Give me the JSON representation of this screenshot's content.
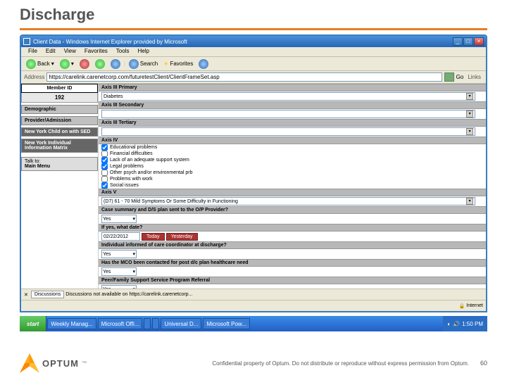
{
  "slide": {
    "title": "Discharge",
    "page": "60"
  },
  "footer": "Confidential property of Optum. Do not distribute or reproduce without express permission from Optum.",
  "logo": "OPTUM",
  "ie": {
    "title": "Client Data - Windows Internet Explorer provided by Microsoft",
    "menu": [
      "File",
      "Edit",
      "View",
      "Favorites",
      "Tools",
      "Help"
    ],
    "back": "Back",
    "search": "Search",
    "favorites": "Favorites",
    "address_label": "Address",
    "url": "https://carelink.carenetcorp.com/futuretestClient/ClientFrameSet.asp",
    "go": "Go",
    "links": "Links",
    "discussions_tab": "Discussions",
    "discussions_msg": "Discussions not available on https://carelink.carenetcorp...",
    "internet": "Internet",
    "sidebar": {
      "member_label": "Member ID",
      "member_value": "192",
      "items": [
        "Demographic",
        "Provider/Admission",
        "New York Child on with SED",
        "New York Individual Information Matrix"
      ],
      "talk_to": "Talk to:",
      "main_menu": "Main Menu"
    },
    "sections": {
      "axis3p": "Axis III Primary",
      "axis3p_val": "Diabetes",
      "axis3s": "Axis III Secondary",
      "axis3t": "Axis III Tertiary",
      "axis4": "Axis IV",
      "axis4_items": [
        {
          "label": "Educational problems",
          "checked": true
        },
        {
          "label": "Financial difficulties",
          "checked": false
        },
        {
          "label": "Lack of an adequate support system",
          "checked": true
        },
        {
          "label": "Legal problems",
          "checked": true
        },
        {
          "label": "Other psych and/or environmental prb",
          "checked": false
        },
        {
          "label": "Problems with work",
          "checked": false
        },
        {
          "label": "Social issues",
          "checked": true
        }
      ],
      "axis5": "Axis V",
      "axis5_val": "(D7) 61 - 70 Mild Symptoms Or Some Difficulty in Functioning",
      "case_summary": "Case summary and D/S plan sent to the O/P Provider?",
      "yes": "Yes",
      "if_yes": "If yes, what date?",
      "date": "02/22/2012",
      "today": "Today",
      "yesterday": "Yesterday",
      "informed": "Individual informed of care coordinator at discharge?",
      "mco": "Has the MCO been contacted for post d/c plan healthcare need",
      "peer": "Peer/Family Support Service Program Referral"
    }
  },
  "taskbar": {
    "start": "start",
    "items": [
      "Weekly Manag...",
      "Microsoft Offi...",
      "",
      "",
      "Universal D...",
      "Microsoft Pow..."
    ],
    "time": "1:50 PM"
  }
}
